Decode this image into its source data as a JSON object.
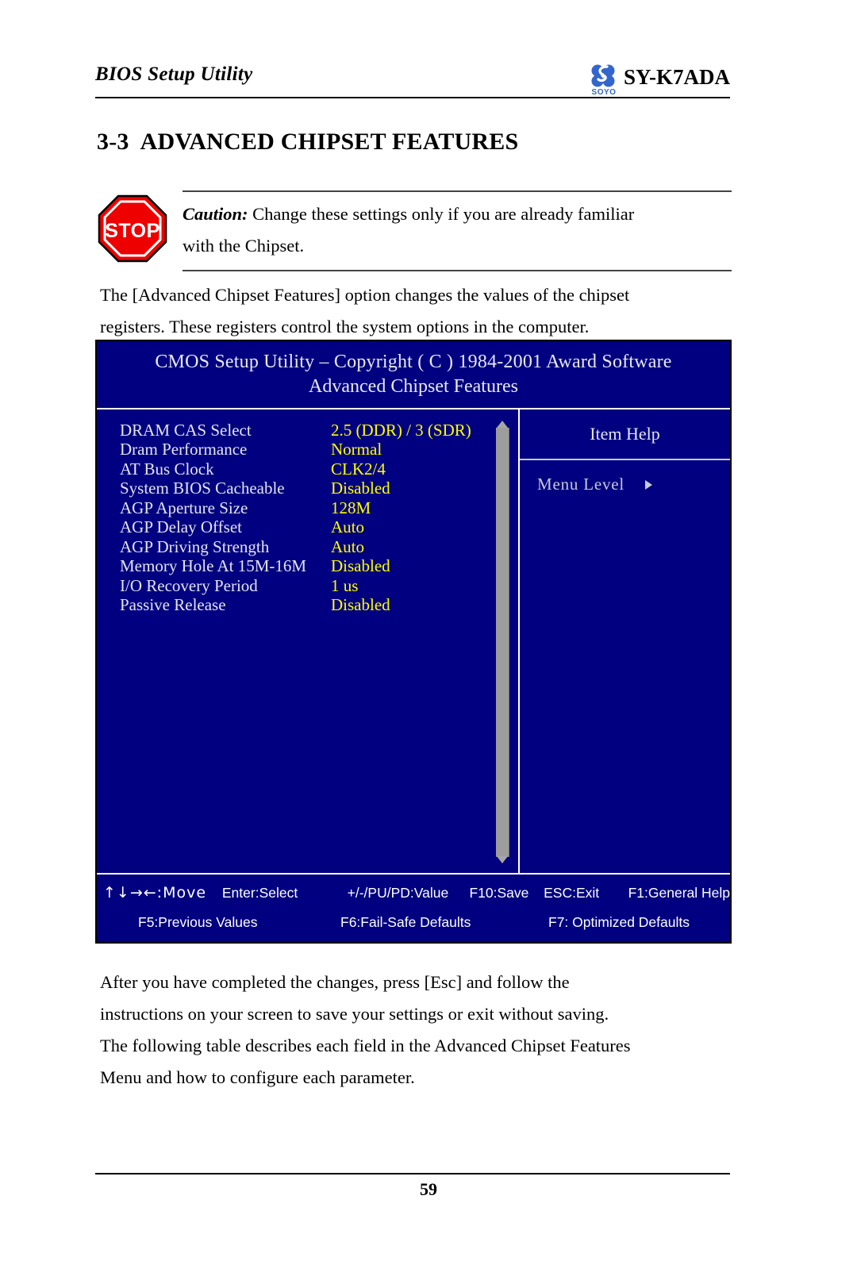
{
  "header": {
    "doc_title": "BIOS Setup Utility",
    "logo_text": "SOYO",
    "model": "SY-K7ADA"
  },
  "section": {
    "number": "3-3",
    "title": "ADVANCED CHIPSET FEATURES"
  },
  "caution": {
    "icon": "stop-sign-icon",
    "sign_text": "STOP",
    "keyword": "Caution:",
    "line1": " Change these settings only if you are already familiar",
    "line2": "with the Chipset."
  },
  "intro": {
    "line1": "The [Advanced Chipset Features] option changes the values of the chipset",
    "line2": "registers. These registers control the system options in the computer."
  },
  "bios": {
    "title_line1": "CMOS Setup Utility – Copyright ( C ) 1984-2001 Award Software",
    "title_line2": "Advanced Chipset Features",
    "settings": [
      {
        "label": "DRAM CAS Select",
        "value": "2.5 (DDR) / 3 (SDR)"
      },
      {
        "label": "Dram Performance",
        "value": "Normal"
      },
      {
        "label": "AT Bus Clock",
        "value": "CLK2/4"
      },
      {
        "label": "System BIOS Cacheable",
        "value": "Disabled"
      },
      {
        "label": "AGP Aperture Size",
        "value": "128M"
      },
      {
        "label": "AGP Delay Offset",
        "value": "Auto"
      },
      {
        "label": "AGP Driving Strength",
        "value": "Auto"
      },
      {
        "label": "Memory Hole At 15M-16M",
        "value": "Disabled"
      },
      {
        "label": "I/O Recovery Period",
        "value": "1 us"
      },
      {
        "label": "Passive Release",
        "value": "Disabled"
      }
    ],
    "help": {
      "title": "Item Help",
      "menu_level_label": "Menu Level",
      "menu_level_arrow": "right-triangle-icon"
    },
    "scrollbar": {
      "up_arrow": "scroll-up-arrow-icon",
      "down_arrow": "scroll-down-arrow-icon"
    },
    "keys_row1": [
      "↑↓→←:Move",
      "Enter:Select",
      "+/-/PU/PD:Value",
      "F10:Save",
      "ESC:Exit",
      "F1:General Help"
    ],
    "keys_row2": [
      "F5:Previous Values",
      "F6:Fail-Safe Defaults",
      "F7: Optimized Defaults"
    ]
  },
  "outro": {
    "line1": "After you have completed the changes, press [Esc] and follow the",
    "line2": "instructions on your screen to save your settings or exit without saving.",
    "line3": "The following table describes each field in the Advanced Chipset Features",
    "line4": "Menu and how to configure each parameter."
  },
  "footer": {
    "page_number": "59"
  },
  "colors": {
    "bios_background": "#000080",
    "bios_label": "#E4E4EE",
    "bios_value": "#FFFF00",
    "stop_red": "#EE0000",
    "logo_blue": "#3366CC"
  }
}
